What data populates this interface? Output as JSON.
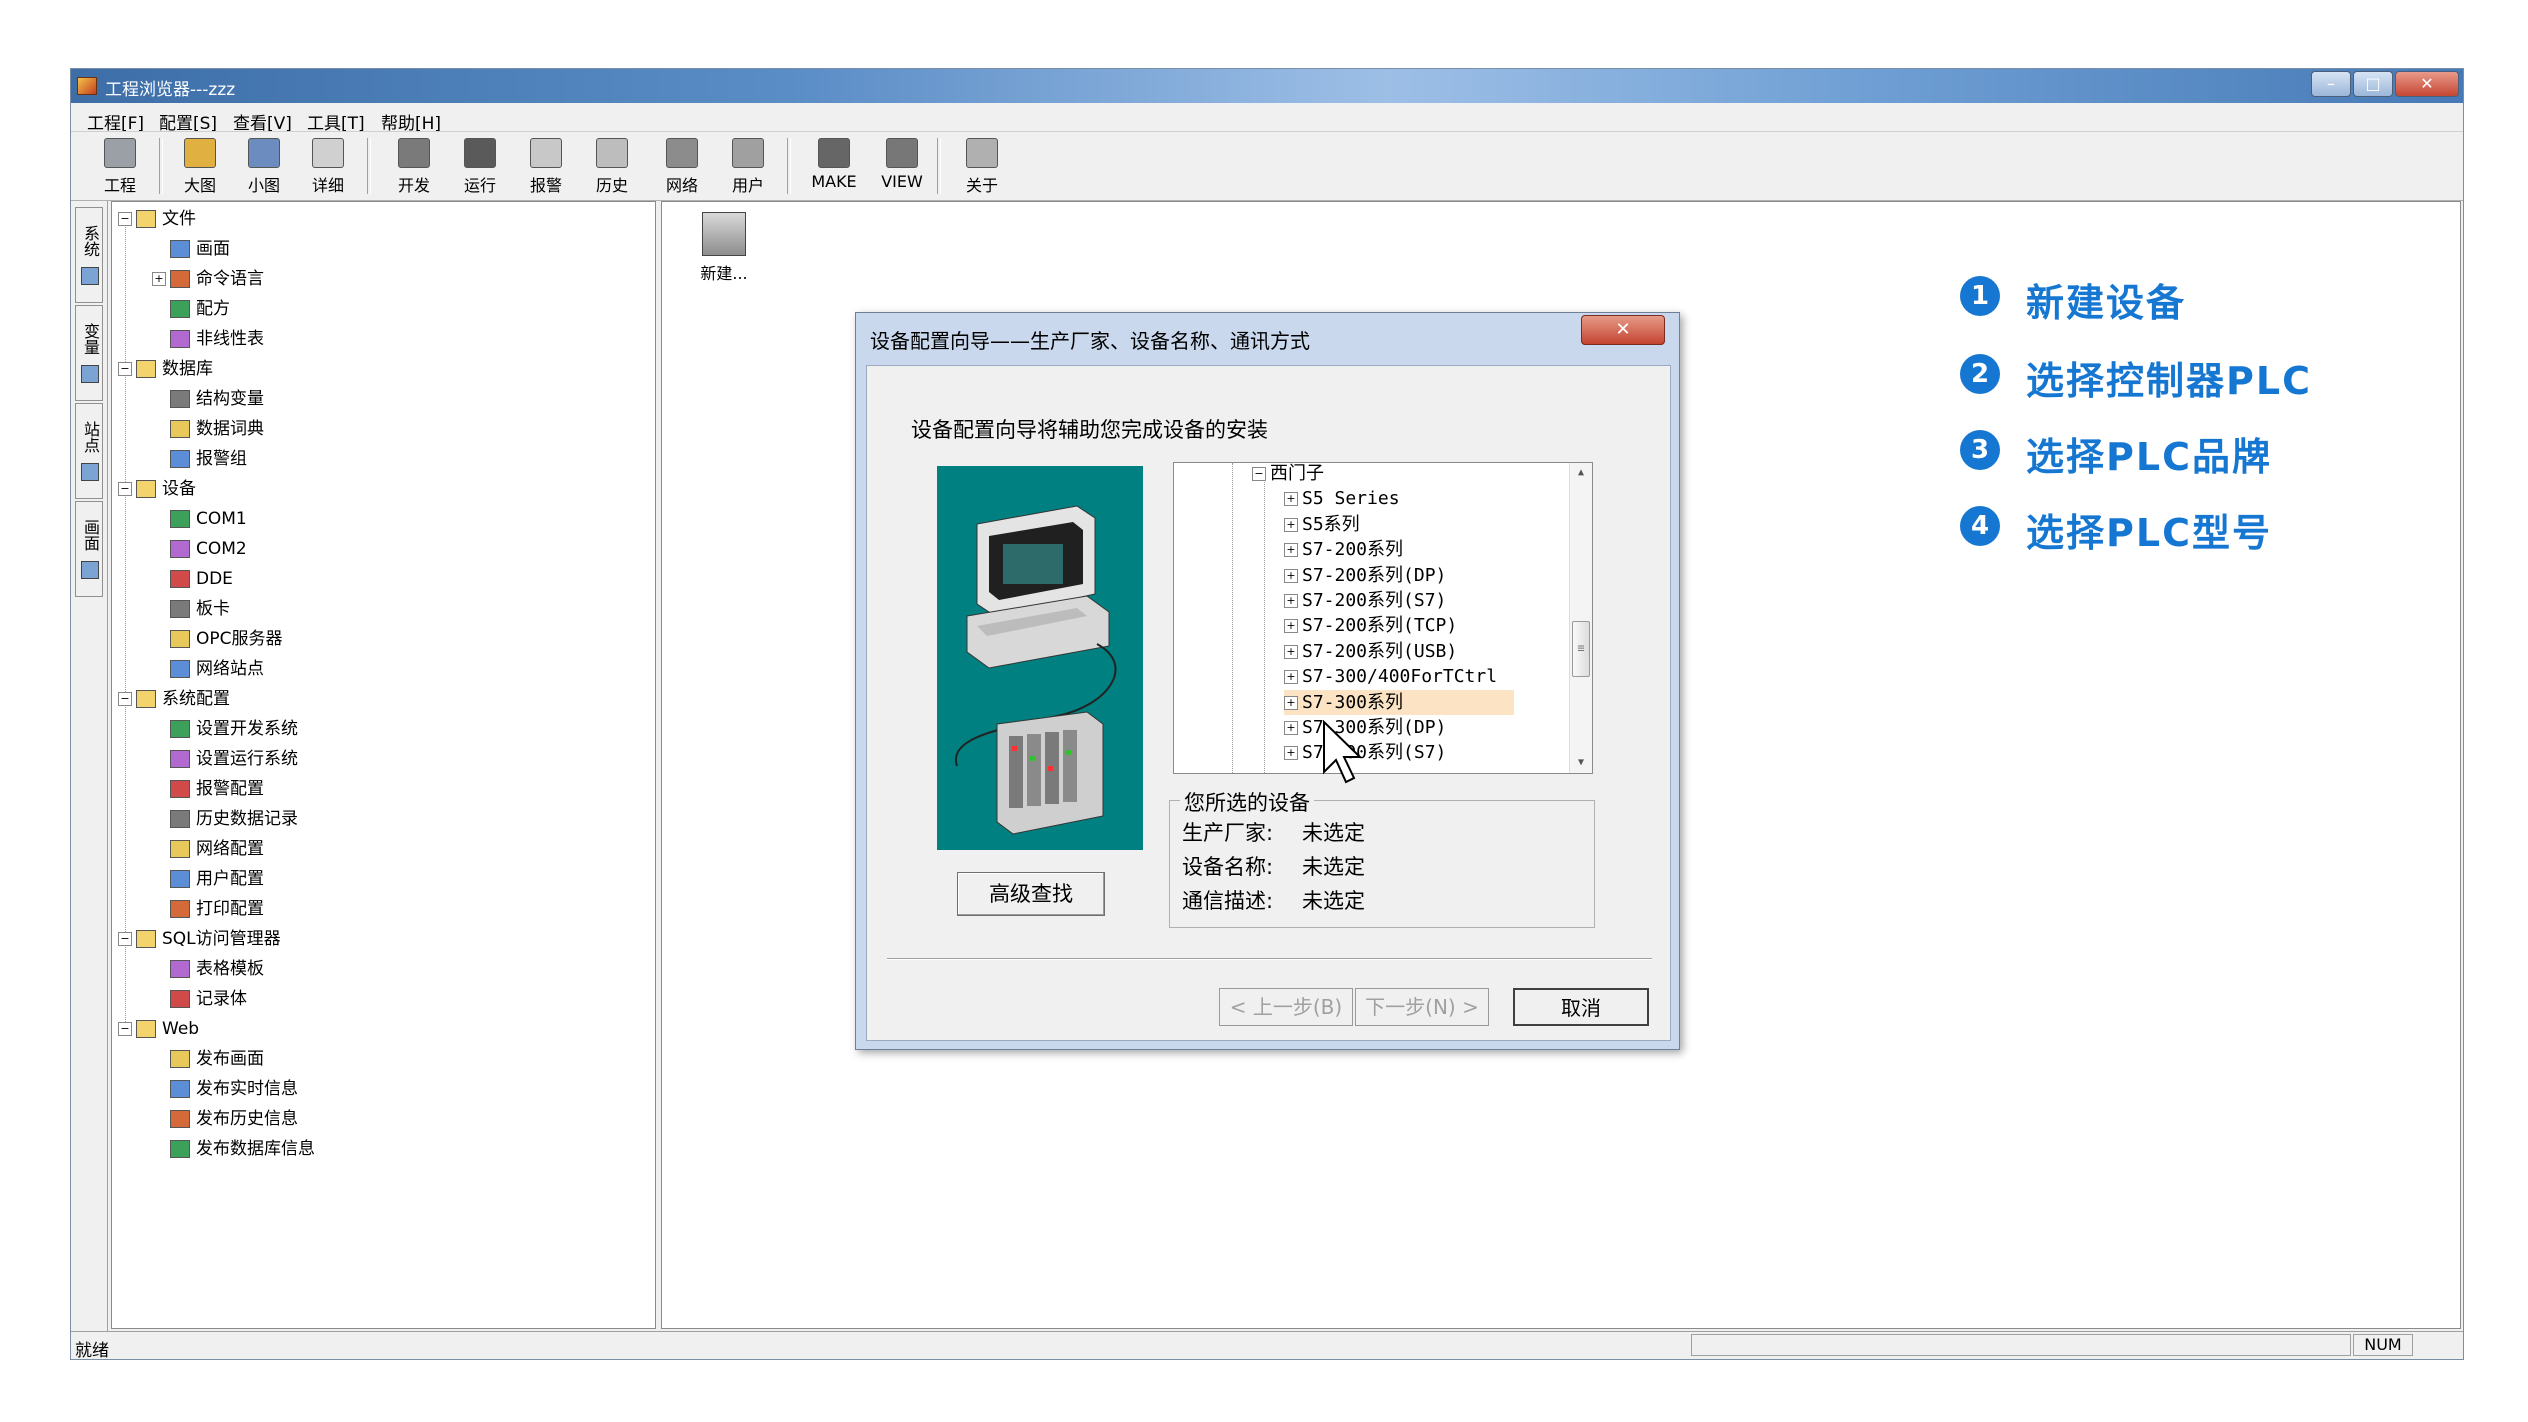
{
  "window": {
    "title": "工程浏览器---zzz",
    "min": "–",
    "max": "□",
    "close": "✕"
  },
  "menu": [
    "工程[F]",
    "配置[S]",
    "查看[V]",
    "工具[T]",
    "帮助[H]"
  ],
  "toolbar": [
    {
      "label": "工程",
      "icon": "project-icon"
    },
    {
      "label": "大图",
      "icon": "large-icon-view-icon"
    },
    {
      "label": "小图",
      "icon": "small-icon-view-icon"
    },
    {
      "label": "详细",
      "icon": "detail-view-icon"
    },
    {
      "label": "开发",
      "icon": "develop-icon"
    },
    {
      "label": "运行",
      "icon": "run-icon"
    },
    {
      "label": "报警",
      "icon": "alarm-icon"
    },
    {
      "label": "历史",
      "icon": "history-icon"
    },
    {
      "label": "网络",
      "icon": "network-icon"
    },
    {
      "label": "用户",
      "icon": "user-icon"
    },
    {
      "label": "MAKE",
      "icon": "make-icon"
    },
    {
      "label": "VIEW",
      "icon": "view-icon"
    },
    {
      "label": "关于",
      "icon": "about-icon"
    }
  ],
  "side_tabs": [
    "系统",
    "变量",
    "站点",
    "画面"
  ],
  "tree": [
    {
      "label": "文件",
      "level": 0,
      "expander": "⊟"
    },
    {
      "label": "画面",
      "level": 1
    },
    {
      "label": "命令语言",
      "level": 1,
      "expander": "⊞"
    },
    {
      "label": "配方",
      "level": 1
    },
    {
      "label": "非线性表",
      "level": 1
    },
    {
      "label": "数据库",
      "level": 0,
      "expander": "⊟"
    },
    {
      "label": "结构变量",
      "level": 1
    },
    {
      "label": "数据词典",
      "level": 1
    },
    {
      "label": "报警组",
      "level": 1
    },
    {
      "label": "设备",
      "level": 0,
      "expander": "⊟"
    },
    {
      "label": "COM1",
      "level": 1
    },
    {
      "label": "COM2",
      "level": 1
    },
    {
      "label": "DDE",
      "level": 1
    },
    {
      "label": "板卡",
      "level": 1
    },
    {
      "label": "OPC服务器",
      "level": 1
    },
    {
      "label": "网络站点",
      "level": 1
    },
    {
      "label": "系统配置",
      "level": 0,
      "expander": "⊟"
    },
    {
      "label": "设置开发系统",
      "level": 1
    },
    {
      "label": "设置运行系统",
      "level": 1
    },
    {
      "label": "报警配置",
      "level": 1
    },
    {
      "label": "历史数据记录",
      "level": 1
    },
    {
      "label": "网络配置",
      "level": 1
    },
    {
      "label": "用户配置",
      "level": 1
    },
    {
      "label": "打印配置",
      "level": 1
    },
    {
      "label": "SQL访问管理器",
      "level": 0,
      "expander": "⊟"
    },
    {
      "label": "表格模板",
      "level": 1
    },
    {
      "label": "记录体",
      "level": 1
    },
    {
      "label": "Web",
      "level": 0,
      "expander": "⊟"
    },
    {
      "label": "发布画面",
      "level": 1
    },
    {
      "label": "发布实时信息",
      "level": 1
    },
    {
      "label": "发布历史信息",
      "level": 1
    },
    {
      "label": "发布数据库信息",
      "level": 1
    }
  ],
  "content": {
    "new_device_label": "新建..."
  },
  "status": {
    "ready": "就绪",
    "num": "NUM"
  },
  "dialog": {
    "title": "设备配置向导——生产厂家、设备名称、通讯方式",
    "close": "✕",
    "intro": "设备配置向导将辅助您完成设备的安装",
    "advanced_search": "高级查找",
    "vendor_tree": [
      {
        "label": "西门子",
        "expander": "⊟",
        "indent": 1
      },
      {
        "label": "S5 Series",
        "expander": "⊞",
        "indent": 2
      },
      {
        "label": "S5系列",
        "expander": "⊞",
        "indent": 2
      },
      {
        "label": "S7-200系列",
        "expander": "⊞",
        "indent": 2
      },
      {
        "label": "S7-200系列(DP)",
        "expander": "⊞",
        "indent": 2
      },
      {
        "label": "S7-200系列(S7)",
        "expander": "⊞",
        "indent": 2
      },
      {
        "label": "S7-200系列(TCP)",
        "expander": "⊞",
        "indent": 2
      },
      {
        "label": "S7-200系列(USB)",
        "expander": "⊞",
        "indent": 2
      },
      {
        "label": "S7-300/400ForTCtrl",
        "expander": "⊞",
        "indent": 2
      },
      {
        "label": "S7-300系列",
        "expander": "⊞",
        "indent": 2,
        "selected": true
      },
      {
        "label": "S7-300系列(DP)",
        "expander": "⊞",
        "indent": 2
      },
      {
        "label": "S7-300系列(S7)",
        "expander": "⊞",
        "indent": 2
      }
    ],
    "selection": {
      "legend": "您所选的设备",
      "rows": [
        {
          "key": "生产厂家:",
          "value": "未选定"
        },
        {
          "key": "设备名称:",
          "value": "未选定"
        },
        {
          "key": "通信描述:",
          "value": "未选定"
        }
      ]
    },
    "buttons": {
      "prev": "< 上一步(B)",
      "next": "下一步(N) >",
      "cancel": "取消"
    }
  },
  "callouts": [
    {
      "num": "1",
      "text": "新建设备"
    },
    {
      "num": "2",
      "text": "选择控制器PLC"
    },
    {
      "num": "3",
      "text": "选择PLC品牌"
    },
    {
      "num": "4",
      "text": "选择PLC型号"
    }
  ],
  "colors": {
    "accent": "#1677d2",
    "selection": "#fbe3c4",
    "illustration_bg": "#008080"
  }
}
